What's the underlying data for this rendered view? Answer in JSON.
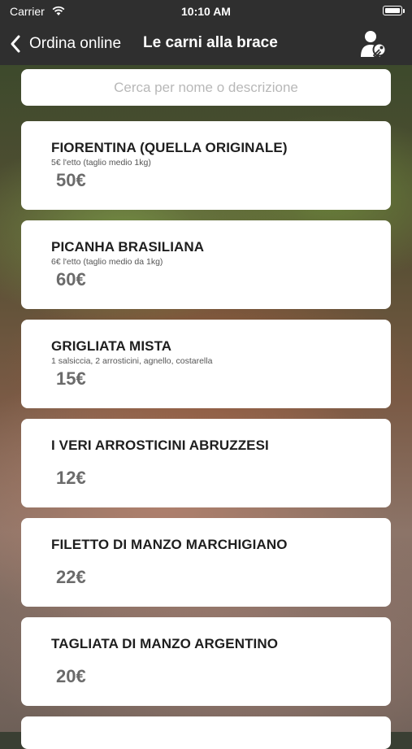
{
  "status_bar": {
    "carrier": "Carrier",
    "time": "10:10 AM"
  },
  "nav": {
    "back_label": "Ordina online",
    "title": "Le carni alla brace",
    "icons": {
      "back": "chevron-left-icon",
      "user": "user-key-icon"
    }
  },
  "search": {
    "placeholder": "Cerca per nome o descrizione",
    "value": ""
  },
  "items": [
    {
      "name": "FIORENTINA (QUELLA ORIGINALE)",
      "description": "5€ l'etto (taglio medio 1kg)",
      "price": "50€"
    },
    {
      "name": "PICANHA BRASILIANA",
      "description": "6€ l'etto (taglio medio da 1kg)",
      "price": "60€"
    },
    {
      "name": "GRIGLIATA MISTA",
      "description": "1 salsiccia, 2 arrosticini, agnello, costarella",
      "price": "15€"
    },
    {
      "name": "I VERI ARROSTICINI ABRUZZESI",
      "description": "",
      "price": "12€"
    },
    {
      "name": "FILETTO DI MANZO MARCHIGIANO",
      "description": "",
      "price": "22€"
    },
    {
      "name": "TAGLIATA DI MANZO ARGENTINO",
      "description": "",
      "price": "20€"
    },
    {
      "name": "",
      "description": "",
      "price": ""
    }
  ],
  "colors": {
    "bar_background": "#2f2f2f",
    "card_background": "#ffffff",
    "price_text": "#6b6b6b"
  }
}
